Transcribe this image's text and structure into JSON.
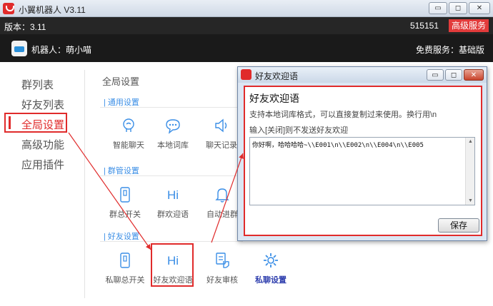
{
  "window": {
    "title": "小翼机器人 V3.11"
  },
  "version_bar": {
    "version": "版本：3.11",
    "number": "515151",
    "premium_button": "高级服务"
  },
  "robot_bar": {
    "robot_name": "机器人：萌小喵",
    "service": "免费服务：基础版"
  },
  "sidebar": {
    "items": [
      {
        "label": "群列表"
      },
      {
        "label": "好友列表"
      },
      {
        "label": "全局设置",
        "active": true
      },
      {
        "label": "高级功能"
      },
      {
        "label": "应用插件"
      }
    ]
  },
  "main": {
    "title": "全局设置",
    "sections": [
      {
        "label": "| 通用设置",
        "features": [
          {
            "label": "智能聊天",
            "icon": "brain-icon"
          },
          {
            "label": "本地词库",
            "icon": "chat-bubble-icon"
          },
          {
            "label": "聊天记录",
            "icon": "speaker-icon"
          }
        ]
      },
      {
        "label": "| 群管设置",
        "features": [
          {
            "label": "群总开关",
            "icon": "switch-icon"
          },
          {
            "label": "群欢迎语",
            "icon": "hi-icon"
          },
          {
            "label": "自动进群",
            "icon": "bell-icon"
          }
        ]
      },
      {
        "label": "| 好友设置",
        "features": [
          {
            "label": "私聊总开关",
            "icon": "switch-icon"
          },
          {
            "label": "好友欢迎语",
            "icon": "hi-icon"
          },
          {
            "label": "好友审核",
            "icon": "hand-check-icon"
          },
          {
            "label": "私聊设置",
            "icon": "gear-icon"
          }
        ]
      }
    ]
  },
  "dialog": {
    "title": "好友欢迎语",
    "heading": "好友欢迎语",
    "description": "支持本地词库格式，可以直接复制过来使用。换行用\\n",
    "hint": "输入[关闭]则不发送好友欢迎",
    "textarea_value": "你好啊，哈哈哈哈~\\\\E001\\n\\\\E002\\n\\\\E004\\n\\\\E005",
    "save_button": "保存"
  },
  "colors": {
    "accent": "#e02b2b",
    "link": "#3a8ee6",
    "dark": "#1a1a1a"
  }
}
